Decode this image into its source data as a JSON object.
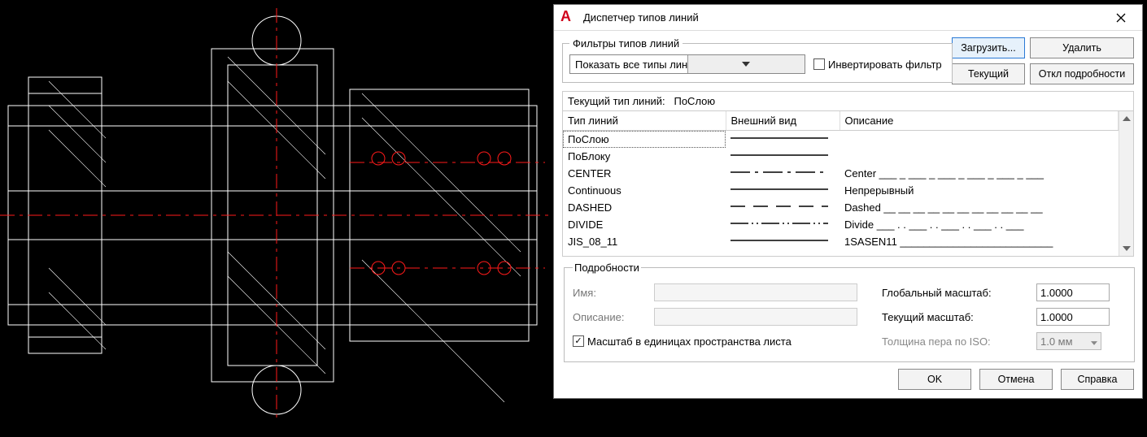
{
  "dialog": {
    "title": "Диспетчер типов линий",
    "filters_legend": "Фильтры типов линий",
    "filter_dropdown": "Показать все типы линий",
    "invert_label": "Инвертировать фильтр",
    "invert_checked": false,
    "buttons": {
      "load": "Загрузить...",
      "delete": "Удалить",
      "current": "Текущий",
      "toggle_details": "Откл подробности"
    },
    "current_linetype_label": "Текущий тип линий:",
    "current_linetype_value": "ПоСлою",
    "columns": {
      "name": "Тип линий",
      "appearance": "Внешний вид",
      "description": "Описание"
    },
    "rows": [
      {
        "name": "ПоСлою",
        "desc": "",
        "pat": "solid"
      },
      {
        "name": "ПоБлоку",
        "desc": "",
        "pat": "solid"
      },
      {
        "name": "CENTER",
        "desc": "Center ___ _ ___ _ ___ _ ___ _ ___ _ ___",
        "pat": "center"
      },
      {
        "name": "Continuous",
        "desc": "Непрерывный",
        "pat": "solid"
      },
      {
        "name": "DASHED",
        "desc": "Dashed __ __ __ __ __ __ __ __ __ __ __",
        "pat": "dashed"
      },
      {
        "name": "DIVIDE",
        "desc": "Divide ___ . . ___ . . ___ . . ___ . . ___",
        "pat": "divide"
      },
      {
        "name": "JIS_08_11",
        "desc": "1SASEN11 __________________________",
        "pat": "solid"
      }
    ],
    "details": {
      "legend": "Подробности",
      "name_label": "Имя:",
      "name_value": "",
      "desc_label": "Описание:",
      "desc_value": "",
      "psp_label": "Масштаб в единицах пространства листа",
      "psp_checked": true,
      "global_scale_label": "Глобальный масштаб:",
      "global_scale_value": "1.0000",
      "current_scale_label": "Текущий масштаб:",
      "current_scale_value": "1.0000",
      "iso_pen_label": "Толщина пера по ISO:",
      "iso_pen_value": "1.0 мм"
    },
    "footer": {
      "ok": "OK",
      "cancel": "Отмена",
      "help": "Справка"
    }
  }
}
